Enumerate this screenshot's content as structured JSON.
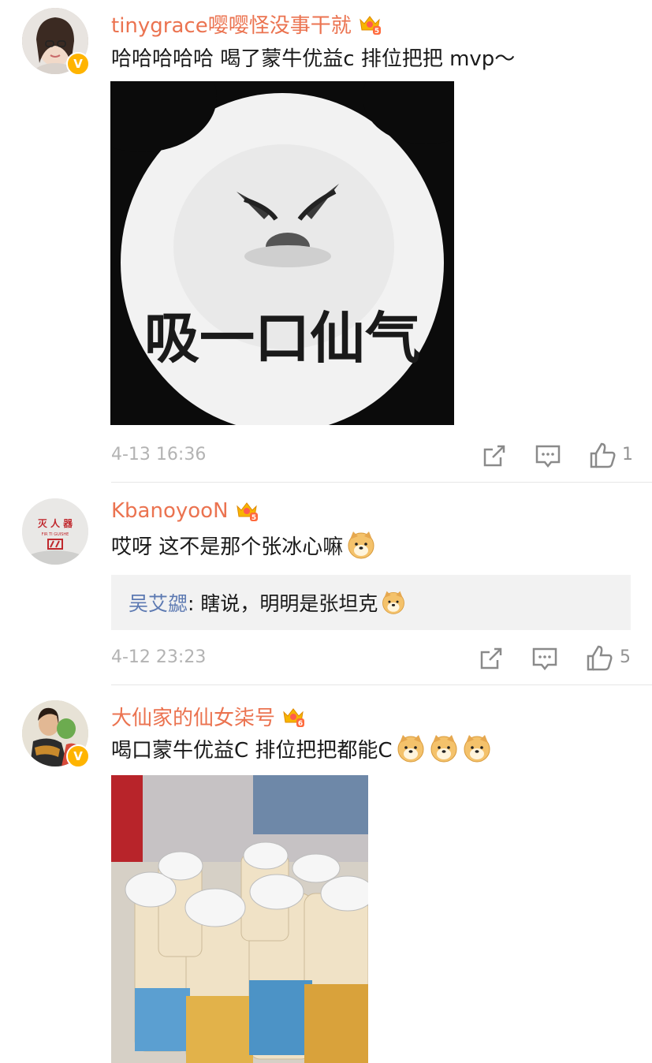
{
  "comments": [
    {
      "username": "tinygrace嘤嘤怪没事干就",
      "text": "哈哈哈哈哈 喝了蒙牛优益c 排位把把 mvp～",
      "image_caption": "吸一口仙气",
      "timestamp": "4-13 16:36",
      "likes": "1",
      "avatar_label": "头像",
      "vip_level": "5"
    },
    {
      "username": "KbanoyooN",
      "text": "哎呀 这不是那个张冰心嘛",
      "reply_name": "吴艾勰",
      "reply_text": ": 瞎说，明明是张坦克",
      "timestamp": "4-12 23:23",
      "likes": "5",
      "avatar_text_top": "灭 人 器",
      "avatar_text_mid": "FIR  TI GUISHE",
      "vip_level": "5"
    },
    {
      "username": "大仙家的仙女柒号",
      "text": "喝口蒙牛优益C 排位把把都能C",
      "timestamp": "",
      "vip_level": "6"
    }
  ],
  "colors": {
    "username": "#eb7350",
    "reply_name": "#5d7ab2",
    "verified_badge": "#ffb400"
  },
  "icons": [
    "share-icon",
    "comment-icon",
    "like-icon",
    "crown-vip-icon",
    "doge-emoji-icon",
    "verified-badge-icon"
  ]
}
